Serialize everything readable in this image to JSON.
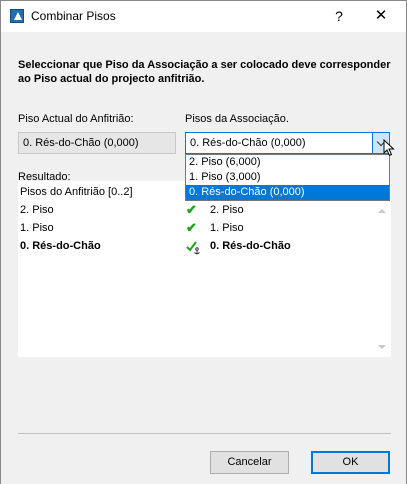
{
  "window": {
    "title": "Combinar Pisos",
    "help_label": "?",
    "close_label": "✕"
  },
  "instruction": "Seleccionar que Piso da Associação a ser colocado deve corresponder ao Piso actual do projecto anfitrião.",
  "host_floor": {
    "label": "Piso Actual do Anfitrião:",
    "value": "0. Rés-do-Chão (0,000)"
  },
  "assoc_floor": {
    "label": "Pisos da Associação.",
    "value": "0. Rés-do-Chão (0,000)",
    "options": [
      "2. Piso (6,000)",
      "1. Piso (3,000)",
      "0. Rés-do-Chão (0,000)"
    ],
    "selected_index": 2
  },
  "result": {
    "label": "Resultado:",
    "rows": [
      {
        "host": "Pisos do Anfitrião [0..2]",
        "mark": "",
        "assoc": ""
      },
      {
        "host": "2. Piso",
        "mark": "check",
        "assoc": "2. Piso"
      },
      {
        "host": "1. Piso",
        "mark": "check",
        "assoc": "1. Piso"
      },
      {
        "host": "0. Rés-do-Chão",
        "mark": "check-anchor",
        "assoc": "0. Rés-do-Chão"
      }
    ]
  },
  "buttons": {
    "cancel": "Cancelar",
    "ok": "OK"
  },
  "colors": {
    "accent": "#0078d7",
    "check": "#1aa51a"
  }
}
